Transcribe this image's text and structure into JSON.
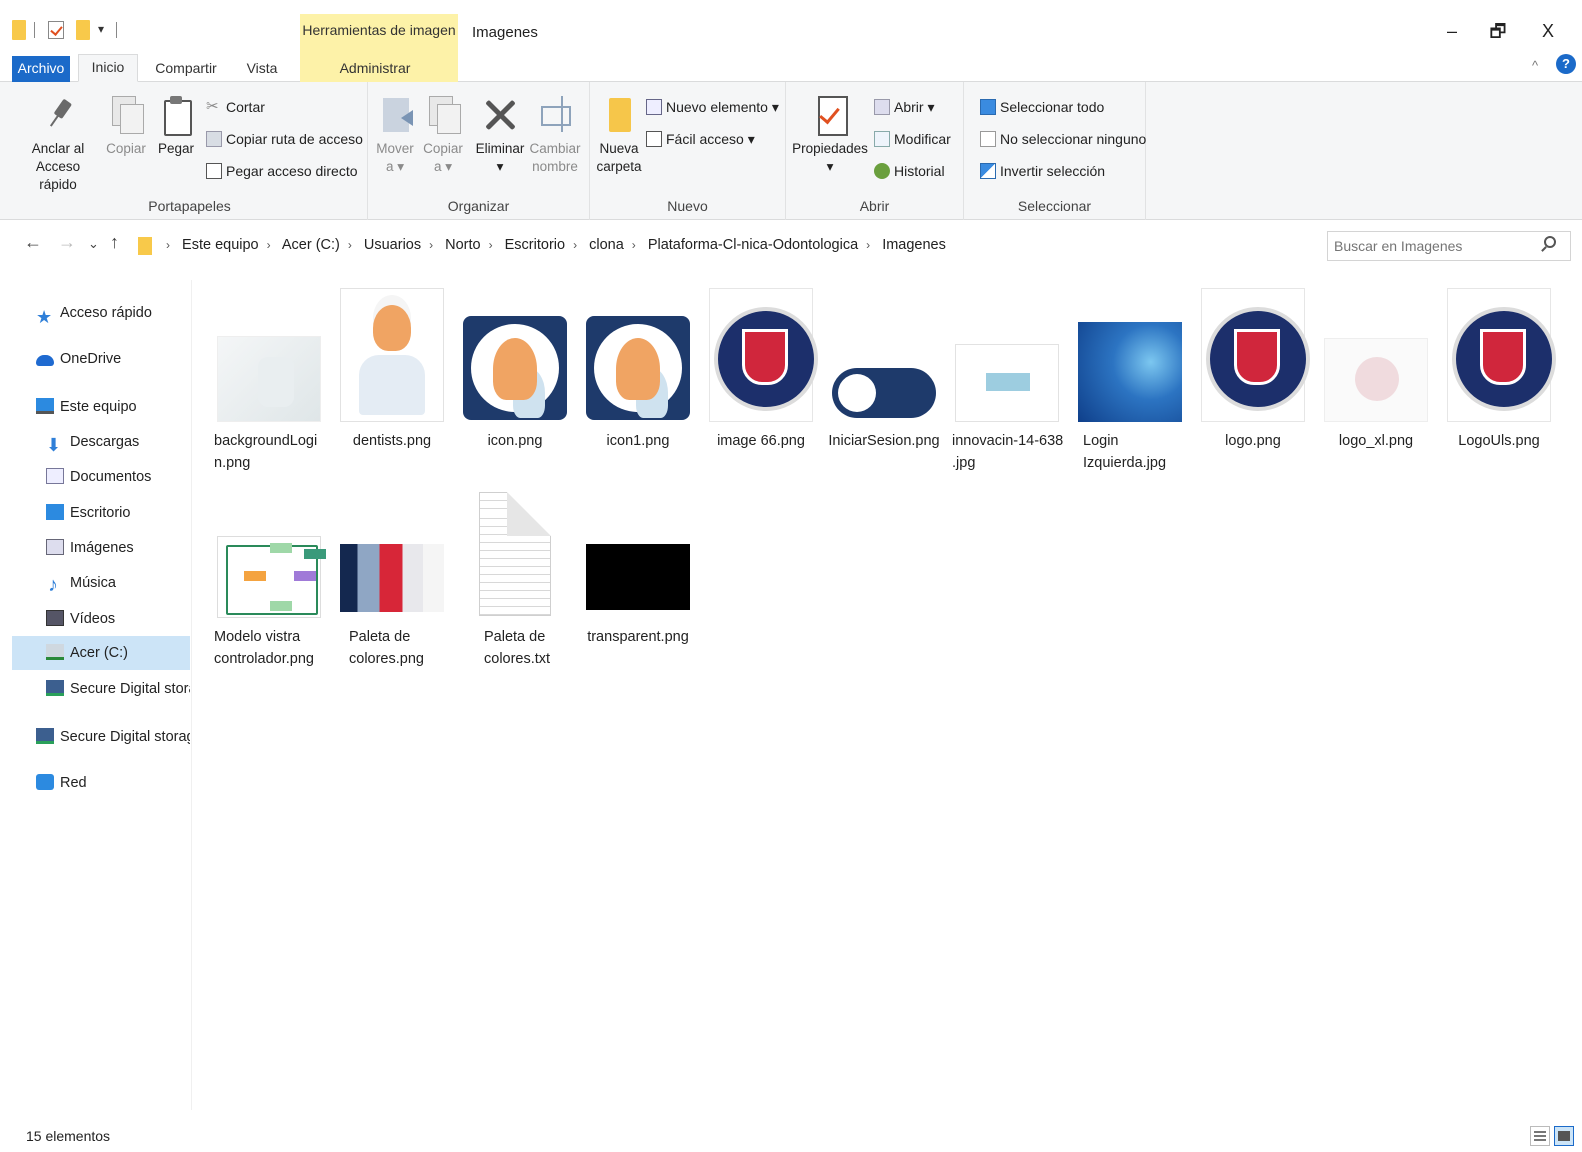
{
  "titlebar": {
    "tools_tab": "Herramientas de imagen",
    "window_title": "Imagenes",
    "minimize": "–",
    "maximize": "🗗",
    "close": "X"
  },
  "ribbon_tabs": {
    "archivo": "Archivo",
    "inicio": "Inicio",
    "compartir": "Compartir",
    "vista": "Vista",
    "administrar": "Administrar",
    "collapse": "^",
    "help": "?"
  },
  "ribbon": {
    "portapapeles": {
      "label": "Portapapeles",
      "pin_line1": "Anclar al",
      "pin_line2": "Acceso rápido",
      "copy": "Copiar",
      "paste": "Pegar",
      "cut": "Cortar",
      "copy_path": "Copiar ruta de acceso",
      "paste_shortcut": "Pegar acceso directo"
    },
    "organizar": {
      "label": "Organizar",
      "move_line1": "Mover",
      "move_line2": "a ▾",
      "copyto_line1": "Copiar",
      "copyto_line2": "a ▾",
      "delete_line1": "Eliminar",
      "delete_line2": "▾",
      "rename_line1": "Cambiar",
      "rename_line2": "nombre"
    },
    "nuevo": {
      "label": "Nuevo",
      "folder_line1": "Nueva",
      "folder_line2": "carpeta",
      "new_item": "Nuevo elemento ▾",
      "easy_access": "Fácil acceso ▾"
    },
    "abrir": {
      "label": "Abrir",
      "props_line1": "Propiedades",
      "props_line2": "▾",
      "open": "Abrir ▾",
      "edit": "Modificar",
      "history": "Historial"
    },
    "seleccionar": {
      "label": "Seleccionar",
      "all": "Seleccionar todo",
      "none": "No seleccionar ninguno",
      "invert": "Invertir selección"
    }
  },
  "address": {
    "back": "←",
    "forward": "→",
    "recent": "⌄",
    "up": "↑",
    "first_sep": "›",
    "crumbs": [
      "Este equipo",
      "Acer (C:)",
      "Usuarios",
      "Norto",
      "Escritorio",
      "clona",
      "Plataforma-Cl-nica-Odontologica",
      "Imagenes"
    ],
    "sep": "›",
    "dropdown": "⌄",
    "refresh": "↻",
    "search_placeholder": "Buscar en Imagenes"
  },
  "nav": {
    "items": [
      {
        "label": "Acceso rápido",
        "icon": "star-icon"
      },
      {
        "label": "OneDrive",
        "icon": "cloud-icon"
      },
      {
        "label": "Este equipo",
        "icon": "computer-icon"
      },
      {
        "label": "Descargas",
        "icon": "download-icon"
      },
      {
        "label": "Documentos",
        "icon": "documents-icon"
      },
      {
        "label": "Escritorio",
        "icon": "desktop-icon"
      },
      {
        "label": "Imágenes",
        "icon": "pictures-icon"
      },
      {
        "label": "Música",
        "icon": "music-icon"
      },
      {
        "label": "Vídeos",
        "icon": "videos-icon"
      },
      {
        "label": "Acer (C:)",
        "icon": "drive-icon"
      },
      {
        "label": "Secure Digital storage",
        "icon": "sd-card-icon"
      },
      {
        "label": "Secure Digital storage",
        "icon": "sd-card-icon"
      },
      {
        "label": "Red",
        "icon": "network-icon"
      }
    ],
    "selected_index": 9
  },
  "files": [
    {
      "name": "backgroundLogin.png",
      "line1": "backgroundLogi",
      "line2": "n.png"
    },
    {
      "name": "dentists.png",
      "line1": "dentists.png",
      "line2": ""
    },
    {
      "name": "icon.png",
      "line1": "icon.png",
      "line2": ""
    },
    {
      "name": "icon1.png",
      "line1": "icon1.png",
      "line2": ""
    },
    {
      "name": "image 66.png",
      "line1": "image 66.png",
      "line2": ""
    },
    {
      "name": "IniciarSesion.png",
      "line1": "IniciarSesion.png",
      "line2": ""
    },
    {
      "name": "innovacin-14-638.jpg",
      "line1": "innovacin-14-638",
      "line2": ".jpg"
    },
    {
      "name": "Login Izquierda.jpg",
      "line1": "Login",
      "line2": "Izquierda.jpg"
    },
    {
      "name": "logo.png",
      "line1": "logo.png",
      "line2": ""
    },
    {
      "name": "logo_xl.png",
      "line1": "logo_xl.png",
      "line2": ""
    },
    {
      "name": "LogoUls.png",
      "line1": "LogoUls.png",
      "line2": ""
    },
    {
      "name": "Modelo vistra controlador.png",
      "line1": "Modelo vistra",
      "line2": "controlador.png"
    },
    {
      "name": "Paleta de colores.png",
      "line1": "Paleta de",
      "line2": "colores.png"
    },
    {
      "name": "Paleta de colores.txt",
      "line1": "Paleta de",
      "line2": "colores.txt"
    },
    {
      "name": "transparent.png",
      "line1": "transparent.png",
      "line2": ""
    }
  ],
  "status": {
    "count": "15 elementos"
  },
  "colors": {
    "accent": "#1b6ac9",
    "tools_tab": "#fdf2a8",
    "selection": "#cce4f7"
  }
}
